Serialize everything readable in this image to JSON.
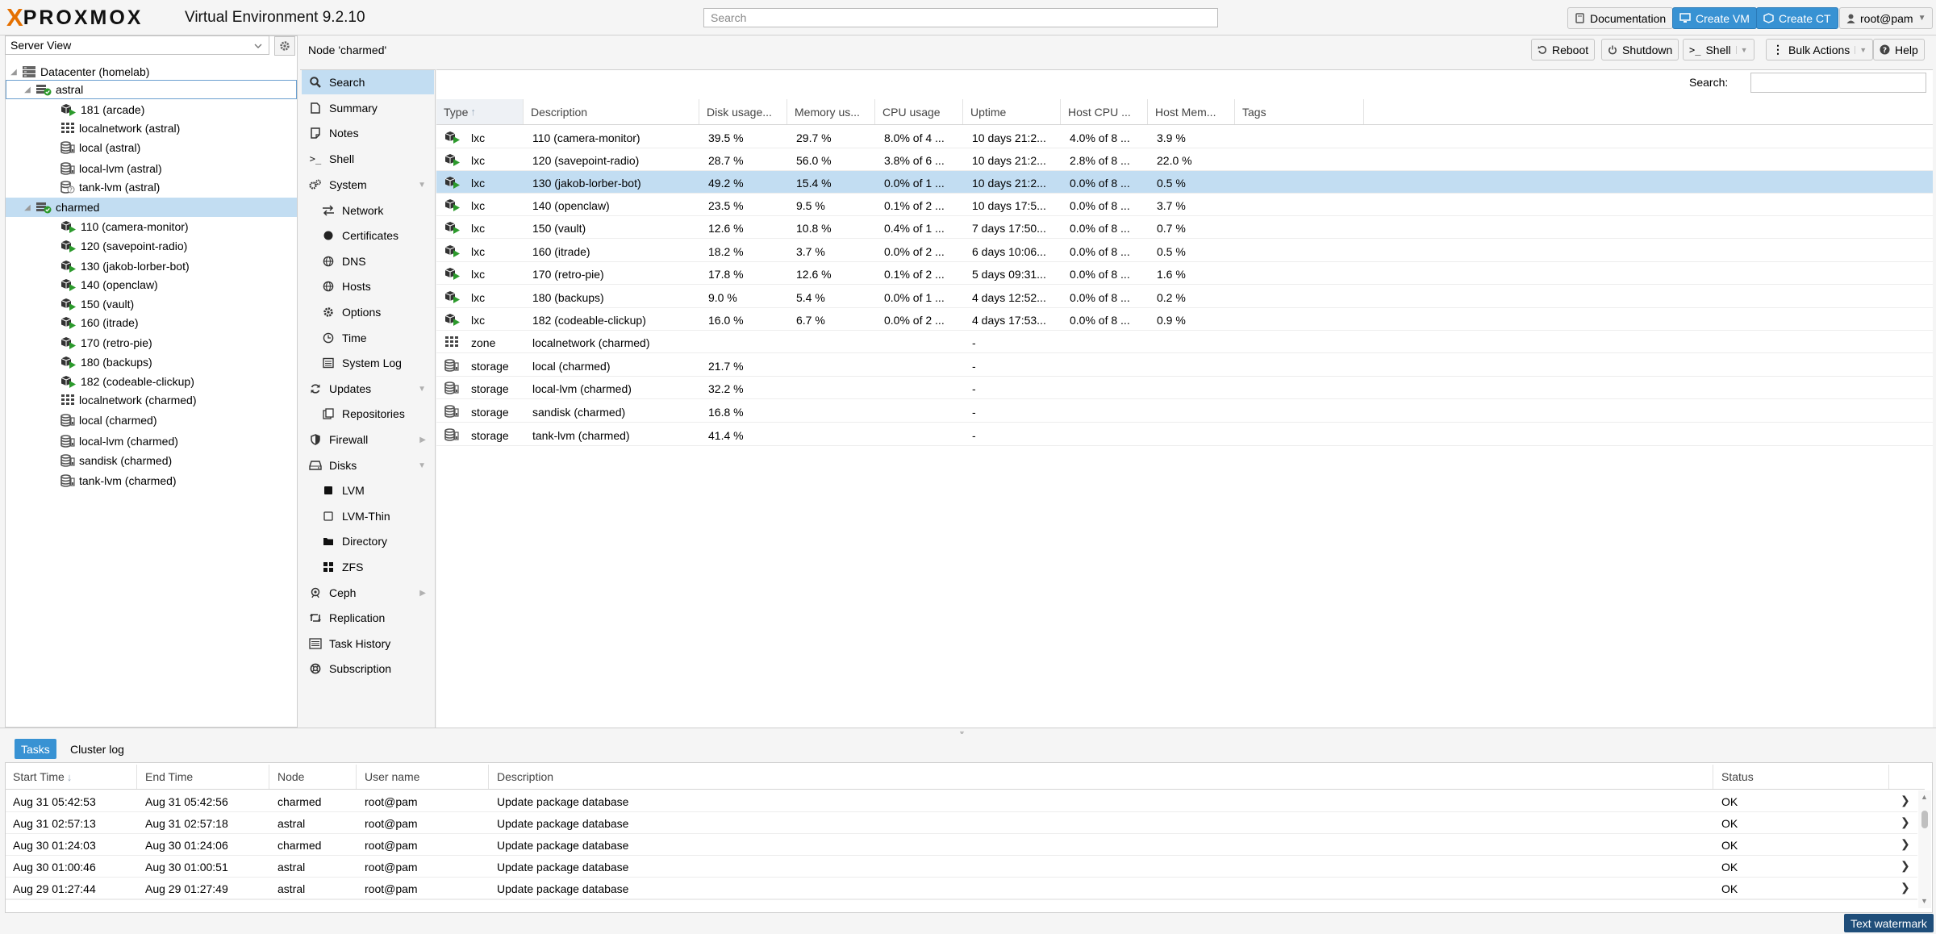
{
  "app": {
    "logo_x": "X",
    "logo_word": "PROXMOX",
    "version_label": "Virtual Environment 9.2.10"
  },
  "colors": {
    "accent": "#3892d3",
    "logo_orange": "#e57000",
    "selection": "#c2ddf2",
    "running_green": "#2c9a2c"
  },
  "header": {
    "search_placeholder": "Search",
    "documentation": "Documentation",
    "create_vm": "Create VM",
    "create_ct": "Create CT",
    "user": "root@pam"
  },
  "tree": {
    "view_select": "Server View",
    "items": [
      {
        "label": "Datacenter (homelab)",
        "icon": "datacenter-icon"
      },
      {
        "label": "astral",
        "icon": "node-online-icon"
      },
      {
        "label": "181 (arcade)",
        "icon": "container-running-icon"
      },
      {
        "label": "localnetwork (astral)",
        "icon": "network-zone-icon"
      },
      {
        "label": "local (astral)",
        "icon": "storage-icon"
      },
      {
        "label": "local-lvm (astral)",
        "icon": "storage-icon"
      },
      {
        "label": "tank-lvm (astral)",
        "icon": "storage-unknown-icon"
      },
      {
        "label": "charmed",
        "icon": "node-online-icon"
      },
      {
        "label": "110 (camera-monitor)",
        "icon": "container-running-icon"
      },
      {
        "label": "120 (savepoint-radio)",
        "icon": "container-running-icon"
      },
      {
        "label": "130 (jakob-lorber-bot)",
        "icon": "container-running-icon"
      },
      {
        "label": "140 (openclaw)",
        "icon": "container-running-icon"
      },
      {
        "label": "150 (vault)",
        "icon": "container-running-icon"
      },
      {
        "label": "160 (itrade)",
        "icon": "container-running-icon"
      },
      {
        "label": "170 (retro-pie)",
        "icon": "container-running-icon"
      },
      {
        "label": "180 (backups)",
        "icon": "container-running-icon"
      },
      {
        "label": "182 (codeable-clickup)",
        "icon": "container-running-icon"
      },
      {
        "label": "localnetwork (charmed)",
        "icon": "network-zone-icon"
      },
      {
        "label": "local (charmed)",
        "icon": "storage-icon"
      },
      {
        "label": "local-lvm (charmed)",
        "icon": "storage-icon"
      },
      {
        "label": "sandisk (charmed)",
        "icon": "storage-icon"
      },
      {
        "label": "tank-lvm (charmed)",
        "icon": "storage-icon"
      }
    ]
  },
  "center": {
    "title": "Node 'charmed'",
    "reboot": "Reboot",
    "shutdown": "Shutdown",
    "shell": "Shell",
    "bulk_actions": "Bulk Actions",
    "help": "Help"
  },
  "nav": {
    "items": [
      {
        "label": "Search",
        "icon": "search-icon"
      },
      {
        "label": "Summary",
        "icon": "summary-icon"
      },
      {
        "label": "Notes",
        "icon": "notes-icon"
      },
      {
        "label": "Shell",
        "icon": "terminal-icon"
      },
      {
        "label": "System",
        "icon": "gears-icon"
      },
      {
        "label": "Network",
        "icon": "network-icon"
      },
      {
        "label": "Certificates",
        "icon": "certificate-icon"
      },
      {
        "label": "DNS",
        "icon": "globe-icon"
      },
      {
        "label": "Hosts",
        "icon": "globe-icon"
      },
      {
        "label": "Options",
        "icon": "gear-icon"
      },
      {
        "label": "Time",
        "icon": "clock-icon"
      },
      {
        "label": "System Log",
        "icon": "log-icon"
      },
      {
        "label": "Updates",
        "icon": "refresh-icon"
      },
      {
        "label": "Repositories",
        "icon": "repository-icon"
      },
      {
        "label": "Firewall",
        "icon": "shield-icon"
      },
      {
        "label": "Disks",
        "icon": "hdd-icon"
      },
      {
        "label": "LVM",
        "icon": "square-filled-icon"
      },
      {
        "label": "LVM-Thin",
        "icon": "square-outline-icon"
      },
      {
        "label": "Directory",
        "icon": "folder-icon"
      },
      {
        "label": "ZFS",
        "icon": "grid-icon"
      },
      {
        "label": "Ceph",
        "icon": "ceph-icon"
      },
      {
        "label": "Replication",
        "icon": "retweet-icon"
      },
      {
        "label": "Task History",
        "icon": "list-icon"
      },
      {
        "label": "Subscription",
        "icon": "support-icon"
      }
    ]
  },
  "grid": {
    "search_label": "Search:",
    "columns": [
      "Type",
      "Description",
      "Disk usage...",
      "Memory us...",
      "CPU usage",
      "Uptime",
      "Host CPU ...",
      "Host Mem...",
      "Tags"
    ],
    "rows": [
      {
        "type": "lxc",
        "description": "110 (camera-monitor)",
        "disk": "39.5 %",
        "memory": "29.7 %",
        "cpu": "8.0% of 4 ...",
        "uptime": "10 days 21:2...",
        "host_cpu": "4.0% of 8 ...",
        "host_mem": "3.9 %",
        "icon": "container-running-icon"
      },
      {
        "type": "lxc",
        "description": "120 (savepoint-radio)",
        "disk": "28.7 %",
        "memory": "56.0 %",
        "cpu": "3.8% of 6 ...",
        "uptime": "10 days 21:2...",
        "host_cpu": "2.8% of 8 ...",
        "host_mem": "22.0 %",
        "icon": "container-running-icon"
      },
      {
        "type": "lxc",
        "description": "130 (jakob-lorber-bot)",
        "disk": "49.2 %",
        "memory": "15.4 %",
        "cpu": "0.0% of 1 ...",
        "uptime": "10 days 21:2...",
        "host_cpu": "0.0% of 8 ...",
        "host_mem": "0.5 %",
        "icon": "container-running-icon"
      },
      {
        "type": "lxc",
        "description": "140 (openclaw)",
        "disk": "23.5 %",
        "memory": "9.5 %",
        "cpu": "0.1% of 2 ...",
        "uptime": "10 days 17:5...",
        "host_cpu": "0.0% of 8 ...",
        "host_mem": "3.7 %",
        "icon": "container-running-icon"
      },
      {
        "type": "lxc",
        "description": "150 (vault)",
        "disk": "12.6 %",
        "memory": "10.8 %",
        "cpu": "0.4% of 1 ...",
        "uptime": "7 days 17:50...",
        "host_cpu": "0.0% of 8 ...",
        "host_mem": "0.7 %",
        "icon": "container-running-icon"
      },
      {
        "type": "lxc",
        "description": "160 (itrade)",
        "disk": "18.2 %",
        "memory": "3.7 %",
        "cpu": "0.0% of 2 ...",
        "uptime": "6 days 10:06...",
        "host_cpu": "0.0% of 8 ...",
        "host_mem": "0.5 %",
        "icon": "container-running-icon"
      },
      {
        "type": "lxc",
        "description": "170 (retro-pie)",
        "disk": "17.8 %",
        "memory": "12.6 %",
        "cpu": "0.1% of 2 ...",
        "uptime": "5 days 09:31...",
        "host_cpu": "0.0% of 8 ...",
        "host_mem": "1.6 %",
        "icon": "container-running-icon"
      },
      {
        "type": "lxc",
        "description": "180 (backups)",
        "disk": "9.0 %",
        "memory": "5.4 %",
        "cpu": "0.0% of 1 ...",
        "uptime": "4 days 12:52...",
        "host_cpu": "0.0% of 8 ...",
        "host_mem": "0.2 %",
        "icon": "container-running-icon"
      },
      {
        "type": "lxc",
        "description": "182 (codeable-clickup)",
        "disk": "16.0 %",
        "memory": "6.7 %",
        "cpu": "0.0% of 2 ...",
        "uptime": "4 days 17:53...",
        "host_cpu": "0.0% of 8 ...",
        "host_mem": "0.9 %",
        "icon": "container-running-icon"
      },
      {
        "type": "zone",
        "description": "localnetwork (charmed)",
        "disk": "",
        "memory": "",
        "cpu": "",
        "uptime": "-",
        "host_cpu": "",
        "host_mem": "",
        "icon": "network-zone-icon"
      },
      {
        "type": "storage",
        "description": "local (charmed)",
        "disk": "21.7 %",
        "memory": "",
        "cpu": "",
        "uptime": "-",
        "host_cpu": "",
        "host_mem": "",
        "icon": "storage-icon"
      },
      {
        "type": "storage",
        "description": "local-lvm (charmed)",
        "disk": "32.2 %",
        "memory": "",
        "cpu": "",
        "uptime": "-",
        "host_cpu": "",
        "host_mem": "",
        "icon": "storage-icon"
      },
      {
        "type": "storage",
        "description": "sandisk (charmed)",
        "disk": "16.8 %",
        "memory": "",
        "cpu": "",
        "uptime": "-",
        "host_cpu": "",
        "host_mem": "",
        "icon": "storage-icon"
      },
      {
        "type": "storage",
        "description": "tank-lvm (charmed)",
        "disk": "41.4 %",
        "memory": "",
        "cpu": "",
        "uptime": "-",
        "host_cpu": "",
        "host_mem": "",
        "icon": "storage-icon"
      }
    ]
  },
  "tasks": {
    "tabs": [
      "Tasks",
      "Cluster log"
    ],
    "columns": [
      "Start Time",
      "End Time",
      "Node",
      "User name",
      "Description",
      "Status"
    ],
    "rows": [
      {
        "start": "Aug 31 05:42:53",
        "end": "Aug 31 05:42:56",
        "node": "charmed",
        "user": "root@pam",
        "description": "Update package database",
        "status": "OK"
      },
      {
        "start": "Aug 31 02:57:13",
        "end": "Aug 31 02:57:18",
        "node": "astral",
        "user": "root@pam",
        "description": "Update package database",
        "status": "OK"
      },
      {
        "start": "Aug 30 01:24:03",
        "end": "Aug 30 01:24:06",
        "node": "charmed",
        "user": "root@pam",
        "description": "Update package database",
        "status": "OK"
      },
      {
        "start": "Aug 30 01:00:46",
        "end": "Aug 30 01:00:51",
        "node": "astral",
        "user": "root@pam",
        "description": "Update package database",
        "status": "OK"
      },
      {
        "start": "Aug 29 01:27:44",
        "end": "Aug 29 01:27:49",
        "node": "astral",
        "user": "root@pam",
        "description": "Update package database",
        "status": "OK"
      }
    ]
  },
  "watermark": "Text watermark"
}
